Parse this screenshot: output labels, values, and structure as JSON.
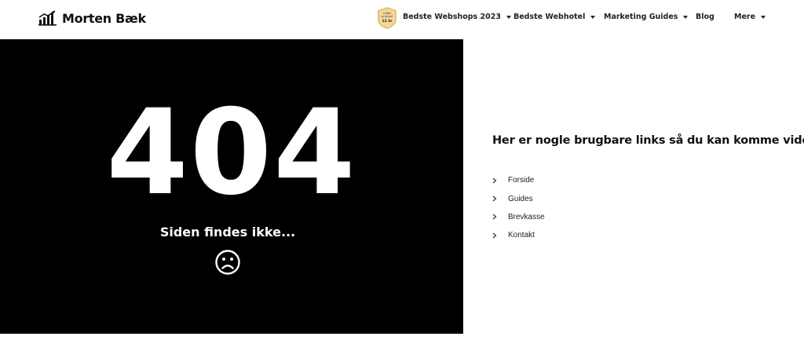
{
  "header": {
    "logo_text": "Morten Bæk",
    "badge": {
      "line1": "Leffler",
      "line2": "er blevet",
      "line3": "12 år"
    },
    "nav": [
      {
        "label": "Bedste Webshops 2023",
        "has_dropdown": true
      },
      {
        "label": "Bedste Webhotel",
        "has_dropdown": true
      },
      {
        "label": "Marketing Guides",
        "has_dropdown": true
      },
      {
        "label": "Blog",
        "has_dropdown": false
      },
      {
        "label": "Mere",
        "has_dropdown": true
      }
    ]
  },
  "error": {
    "code": "404",
    "message": "Siden findes ikke...",
    "icon": "sad-face-icon"
  },
  "links_section": {
    "heading": "Her er nogle brugbare links så du kan komme videre",
    "links": [
      {
        "label": "Forside"
      },
      {
        "label": "Guides"
      },
      {
        "label": "Brevkasse"
      },
      {
        "label": "Kontakt"
      }
    ]
  },
  "colors": {
    "panel_bg": "#000000",
    "text_dark": "#111111",
    "badge_gold": "#e8c27a"
  }
}
